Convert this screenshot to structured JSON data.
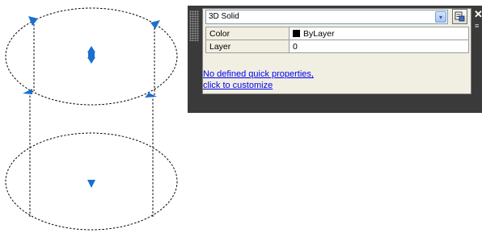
{
  "drawing": {
    "colors": {
      "grip": "#1a6fd1",
      "edge": "#000000"
    },
    "icons": [
      "grip-arrow-icon",
      "move-grip-icon"
    ]
  },
  "quick_properties": {
    "object_type": "3D Solid",
    "rows": [
      {
        "label": "Color",
        "value": "ByLayer",
        "swatch": "#000000"
      },
      {
        "label": "Layer",
        "value": "0"
      }
    ],
    "link_line1": "No defined quick properties,",
    "link_line2": "click to customize",
    "close_glyph": "✕",
    "dropdown_glyph": "▾",
    "colors": {
      "panel": "#3a3a3a",
      "inner": "#f1efe2",
      "link": "#0000ee"
    }
  }
}
